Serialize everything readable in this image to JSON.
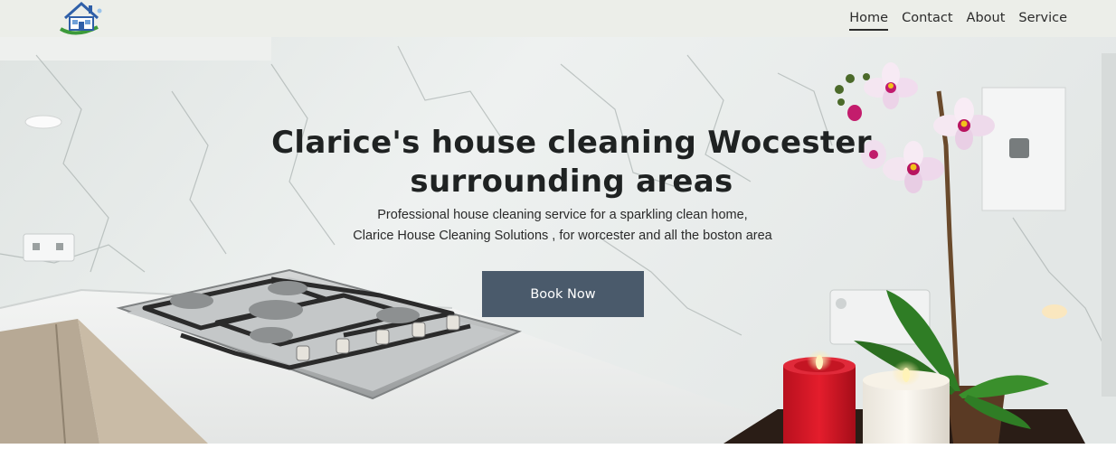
{
  "header": {
    "logo_icon": "house-cleaning-logo-icon",
    "nav": [
      {
        "label": "Home",
        "active": true
      },
      {
        "label": "Contact",
        "active": false
      },
      {
        "label": "About",
        "active": false
      },
      {
        "label": "Service",
        "active": false
      }
    ]
  },
  "hero": {
    "title_line1": "Clarice's house cleaning Wocester",
    "title_line2": "surrounding areas",
    "subtitle_line1": "Professional house cleaning service for a sparkling clean home,",
    "subtitle_line2": "Clarice House Cleaning Solutions , for worcester and all the boston area",
    "cta_label": "Book Now",
    "background_image": "kitchen-marble-stove-orchid-candles",
    "colors": {
      "header_bg": "#eceee9",
      "button_bg": "#4a5a6b",
      "title_text": "#1f2222"
    }
  }
}
